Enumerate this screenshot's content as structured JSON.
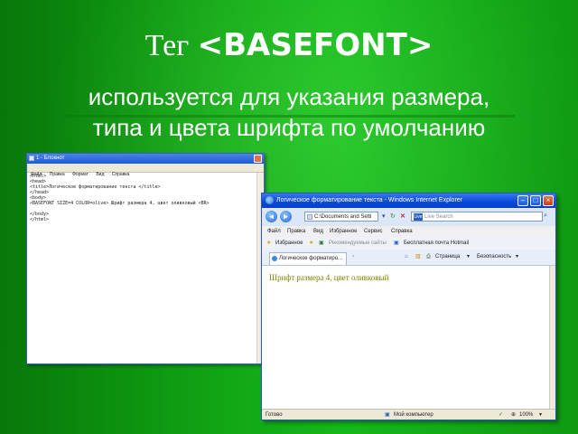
{
  "slide": {
    "title_prefix": "Тег",
    "title_tag": "<BASEFONT>",
    "subtitle_line1": "используется для указания размера,",
    "subtitle_line2": "типа и цвета шрифта по умолчанию"
  },
  "notepad": {
    "title": "1 - Блокнот",
    "menu": [
      "Файл",
      "Правка",
      "Формат",
      "Вид",
      "Справка"
    ],
    "lines": [
      "<html>",
      "<head>",
      "<title>Логическое форматирование текста </title>",
      "</head>",
      "<body>",
      "<BASEFONT SIZE=4 COLOR=olive> Шрифт размера 4, цвет оливковый <BR>",
      "",
      "</body>",
      "</html>"
    ]
  },
  "ie": {
    "title": "Логическое форматирование текста - Windows Internet Explorer",
    "address": "C:\\Documents and Setti",
    "search_placeholder": "Live Search",
    "search_logo": "Live",
    "menu": [
      "Файл",
      "Правка",
      "Вид",
      "Избранное",
      "Сервис",
      "Справка"
    ],
    "favorites": "Избранное",
    "suggested_sites": "Рекомендуемые сайты",
    "hotmail": "Бесплатная почта Hotmail",
    "tab_label": "Логическое форматиро...",
    "page_menu": "Страница",
    "safety_menu": "Безопасность",
    "content_text": "Шрифт размера 4, цвет оливковый",
    "content_color": "#808000",
    "status_left": "Готово",
    "status_zone": "Мой компьютер",
    "zoom": "100%"
  }
}
